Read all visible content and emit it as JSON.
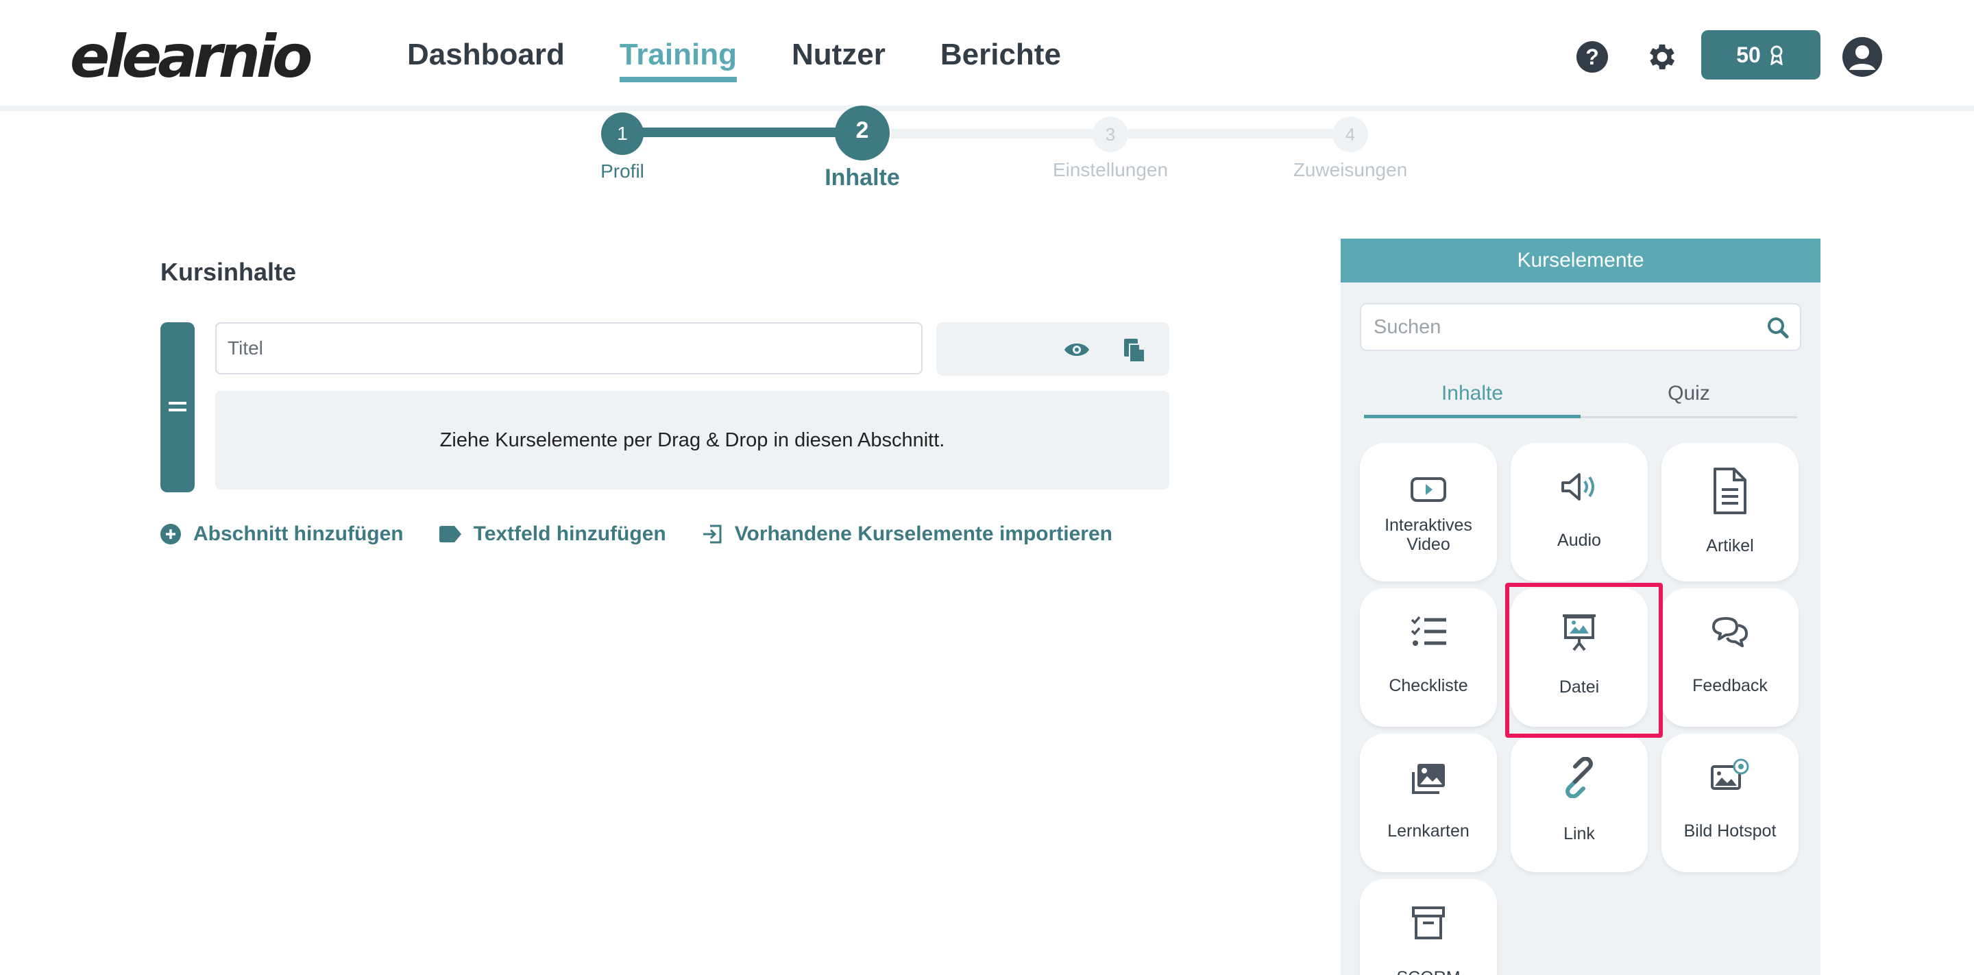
{
  "brand": {
    "logo_text": "elearnio"
  },
  "nav": {
    "items": [
      {
        "label": "Dashboard",
        "active": false
      },
      {
        "label": "Training",
        "active": true
      },
      {
        "label": "Nutzer",
        "active": false
      },
      {
        "label": "Berichte",
        "active": false
      }
    ],
    "help_icon": "question-circle-icon",
    "settings_icon": "gear-icon",
    "credits_label": "50",
    "credits_icon": "award-icon",
    "avatar_icon": "user-circle-icon"
  },
  "stepper": {
    "steps": [
      {
        "number": "1",
        "label": "Profil",
        "state": "done"
      },
      {
        "number": "2",
        "label": "Inhalte",
        "state": "current"
      },
      {
        "number": "3",
        "label": "Einstellungen",
        "state": "todo"
      },
      {
        "number": "4",
        "label": "Zuweisungen",
        "state": "todo"
      }
    ]
  },
  "course": {
    "title": "Kursinhalte",
    "section": {
      "title_placeholder": "Titel",
      "title_value": "",
      "dropzone_text": "Ziehe Kurselemente per Drag & Drop in diesen Abschnitt."
    },
    "actions": [
      {
        "label": "Abschnitt hinzufügen",
        "icon": "plus-circle-icon"
      },
      {
        "label": "Textfeld hinzufügen",
        "icon": "tag-icon"
      },
      {
        "label": "Vorhandene Kurselemente importieren",
        "icon": "import-icon"
      }
    ]
  },
  "panel": {
    "header": "Kurselemente",
    "search_placeholder": "Suchen",
    "tabs": [
      {
        "label": "Inhalte",
        "active": true
      },
      {
        "label": "Quiz",
        "active": false
      }
    ],
    "elements": [
      {
        "label": "Interaktives Video",
        "icon": "video-play-icon"
      },
      {
        "label": "Audio",
        "icon": "speaker-icon"
      },
      {
        "label": "Artikel",
        "icon": "document-icon"
      },
      {
        "label": "Checkliste",
        "icon": "checklist-icon"
      },
      {
        "label": "Datei",
        "icon": "presentation-icon",
        "highlighted": true
      },
      {
        "label": "Feedback",
        "icon": "chat-bubbles-icon"
      },
      {
        "label": "Lernkarten",
        "icon": "image-stack-icon"
      },
      {
        "label": "Link",
        "icon": "link-icon"
      },
      {
        "label": "Bild Hotspot",
        "icon": "image-hotspot-icon"
      },
      {
        "label": "SCORM",
        "icon": "archive-box-icon"
      }
    ]
  },
  "colors": {
    "primary": "#3e7a82",
    "accent": "#5aa9b5",
    "panel_bg": "#eef2f5",
    "highlight": "#e8185a"
  }
}
